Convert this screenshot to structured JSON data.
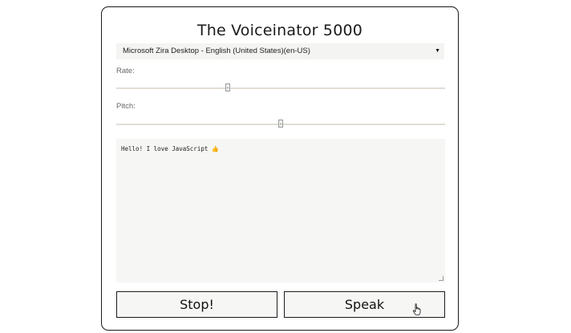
{
  "app": {
    "title": "The Voiceinator 5000"
  },
  "voice_select": {
    "selected": "Microsoft Zira Desktop - English (United States)(en-US)"
  },
  "controls": {
    "rate_label": "Rate:",
    "rate_value_fraction": 0.34,
    "pitch_label": "Pitch:",
    "pitch_value_fraction": 0.5
  },
  "message": {
    "text": "Hello! I love JavaScript 👍"
  },
  "buttons": {
    "stop_label": "Stop!",
    "speak_label": "Speak"
  },
  "icons": {
    "select_arrow": "chevron-down-icon",
    "cursor": "hand-pointer-icon"
  }
}
